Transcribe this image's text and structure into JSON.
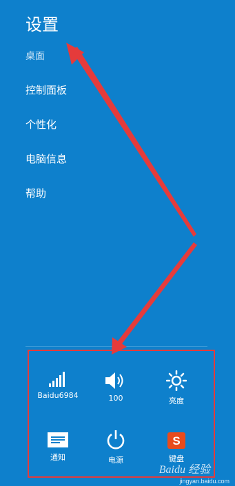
{
  "header": {
    "title": "设置",
    "context": "桌面"
  },
  "menu": [
    {
      "label": "控制面板"
    },
    {
      "label": "个性化"
    },
    {
      "label": "电脑信息"
    },
    {
      "label": "帮助"
    }
  ],
  "tray": {
    "tiles": [
      {
        "label": "Baidu6984",
        "icon": "wifi-signal-icon"
      },
      {
        "label": "100",
        "icon": "volume-icon"
      },
      {
        "label": "亮度",
        "icon": "brightness-icon"
      },
      {
        "label": "通知",
        "icon": "notifications-icon"
      },
      {
        "label": "电源",
        "icon": "power-icon"
      },
      {
        "label": "键盘",
        "icon": "keyboard-ime-icon"
      }
    ]
  },
  "watermark": {
    "logo": "Baidu 经验",
    "url": "jingyan.baidu.com"
  },
  "colors": {
    "background": "#0e80cc",
    "annotation": "#e53b3b"
  }
}
